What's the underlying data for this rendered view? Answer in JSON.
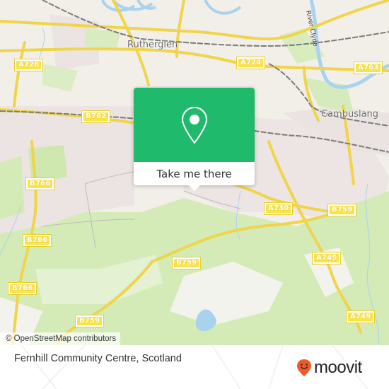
{
  "map": {
    "places": [
      {
        "name": "Rutherglen"
      },
      {
        "name": "Cambuslang"
      }
    ],
    "river_label": "River Clyde",
    "road_shields": [
      "A728",
      "A724",
      "A763",
      "B762",
      "B766",
      "B766",
      "B766",
      "A730",
      "B759",
      "B759",
      "B759",
      "A749",
      "A749"
    ],
    "attribution": "© OpenStreetMap contributors",
    "colors": {
      "land": "#f2efe9",
      "green": "#cfe8b0",
      "light_green": "#e2f0cf",
      "water": "#a8d3ee",
      "road": "#f7e34a",
      "rail": "#7a7a7a"
    }
  },
  "popup": {
    "icon": "map-pin-icon",
    "button_label": "Take me there",
    "accent": "#1fba6c"
  },
  "footer": {
    "title": "Fernhill Community Centre, Scotland",
    "logo_text": "moovit",
    "logo_color": "#f05a28"
  }
}
